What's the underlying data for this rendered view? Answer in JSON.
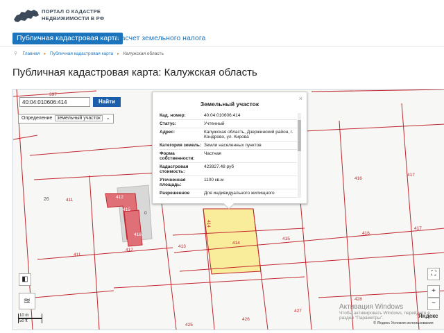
{
  "header": {
    "logo_line1": "ПОРТАЛ О КАДАСТРЕ",
    "logo_line2": "НЕДВИЖИМОСТИ В РФ"
  },
  "nav": {
    "tab_active": "Публичная кадастровая карта",
    "tab_link": "Расчет земельного налога"
  },
  "breadcrumb": {
    "home": "Главная",
    "section": "Публичная кадастровая карта",
    "current": "Калужская область"
  },
  "page_title": "Публичная кадастровая карта: Калужская область",
  "search": {
    "value": "40:04:010606:414",
    "button": "Найти",
    "definition_label": "Определение",
    "definition_value": "земельный участок"
  },
  "popup": {
    "title": "Земельный участок",
    "close": "×",
    "rows": [
      {
        "key": "Кад. номер:",
        "value": "40:04:010606:414"
      },
      {
        "key": "Статус:",
        "value": "Учтенный"
      },
      {
        "key": "Адрес:",
        "value": "Калужская область, Дзержинский район, г. Кондрово, ул. Кирова"
      },
      {
        "key": "Категория земель:",
        "value": "Земли населенных пунктов"
      },
      {
        "key": "Форма собственности:",
        "value": "Частная"
      },
      {
        "key": "Кадастровая стоимость:",
        "value": "423927.48 руб"
      },
      {
        "key": "Уточненная площадь:",
        "value": "1100 кв.м"
      },
      {
        "key": "Разрешенное",
        "value": "Для индивидуального жилищного"
      }
    ]
  },
  "parcels": {
    "p397": "397",
    "p26": "26",
    "p411a": "411",
    "p412a": "412",
    "p415a": "415",
    "p416a": "416",
    "p0": "0",
    "p412b": "412",
    "p411b": "411",
    "p413": "413",
    "p414": "414",
    "p414v": "414",
    "p415b": "415",
    "p416b": "416",
    "p417a": "417",
    "p417b": "417",
    "p425": "425",
    "p426": "426",
    "p427": "427",
    "p428": "428"
  },
  "scale": {
    "m": "10 m",
    "ft": "50 ft"
  },
  "watermark": {
    "line1": "Активация Windows",
    "line2": "Чтобы активировать Windows, перейдите в",
    "line3": "раздел \"Параметры\"."
  },
  "copyright": "© Яндекс Условия использования",
  "yandex": "Яндекс",
  "controls": {
    "zoom_in": "+",
    "zoom_out": "−",
    "fullscreen": "⛶",
    "ruler": "◧",
    "layers": "≋"
  },
  "colors": {
    "accent": "#1c75bc",
    "parcel_line": "#c0262d",
    "selected_parcel": "#f9ec9a",
    "building": "#e07078"
  }
}
